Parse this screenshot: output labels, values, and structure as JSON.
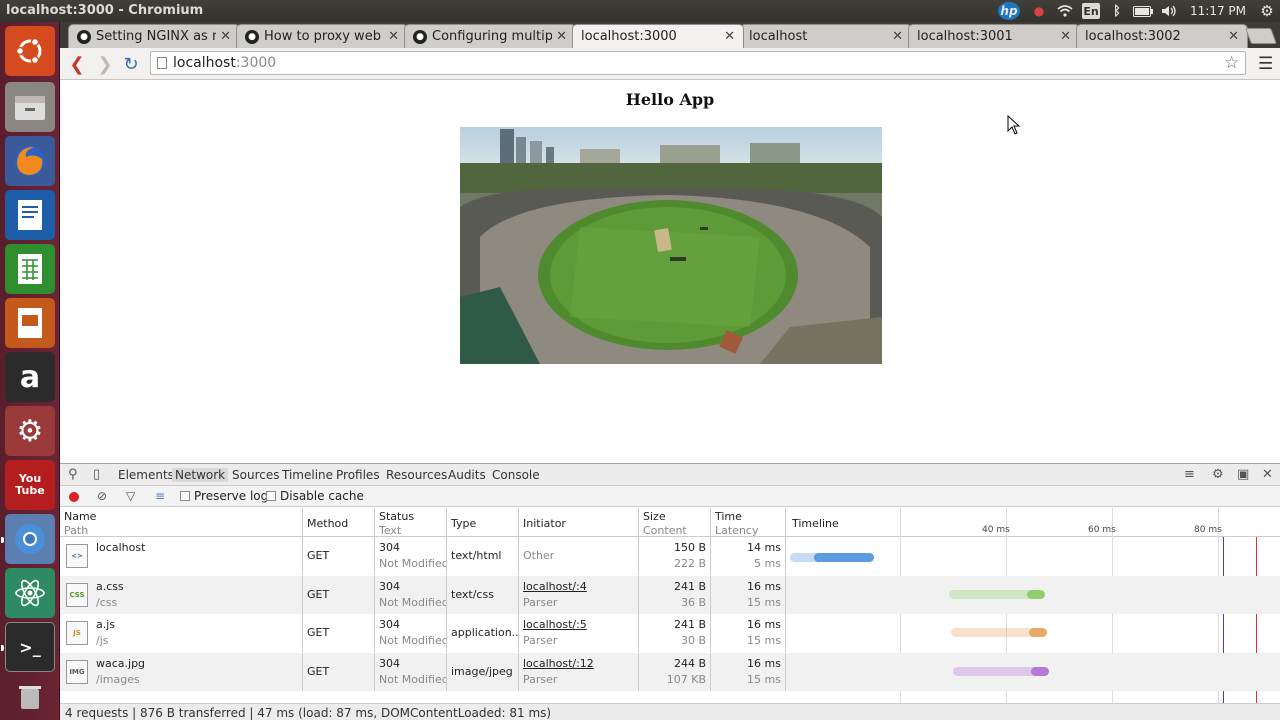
{
  "window": {
    "title": "localhost:3000 - Chromium",
    "clock": "11:17 PM",
    "tray": {
      "lang": "En"
    }
  },
  "launcher": {
    "items": [
      "ubuntu-dash",
      "files",
      "firefox",
      "writer",
      "calc",
      "impress",
      "amazon",
      "system-settings",
      "youtube",
      "chromium",
      "atom",
      "terminal",
      "trash"
    ]
  },
  "tabs": [
    {
      "label": "Setting NGINX as re",
      "icon": "github-icon",
      "active": false
    },
    {
      "label": "How to proxy web a",
      "icon": "github-icon",
      "active": false
    },
    {
      "label": "Configuring multipl",
      "icon": "github-icon",
      "active": false
    },
    {
      "label": "localhost:3000",
      "icon": "",
      "active": true
    },
    {
      "label": "localhost",
      "icon": "",
      "active": false
    },
    {
      "label": "localhost:3001",
      "icon": "",
      "active": false
    },
    {
      "label": "localhost:3002",
      "icon": "",
      "active": false
    }
  ],
  "address": {
    "host": "localhost",
    "port": ":3000"
  },
  "page": {
    "heading": "Hello App"
  },
  "devtools": {
    "tabs": [
      "Elements",
      "Network",
      "Sources",
      "Timeline",
      "Profiles",
      "Resources",
      "Audits",
      "Console"
    ],
    "active_tab": "Network",
    "toolbar": {
      "preserve_log": "Preserve log",
      "disable_cache": "Disable cache"
    },
    "columns": {
      "name": "Name",
      "name_sub": "Path",
      "method": "Method",
      "status": "Status",
      "status_sub": "Text",
      "type": "Type",
      "initiator": "Initiator",
      "size": "Size",
      "size_sub": "Content",
      "time": "Time",
      "time_sub": "Latency",
      "timeline": "Timeline"
    },
    "timeline_ticks": [
      "40 ms",
      "60 ms",
      "80 ms"
    ],
    "rows": [
      {
        "name": "localhost",
        "path": "",
        "method": "GET",
        "status": "304",
        "status_text": "Not Modified",
        "type": "text/html",
        "initiator": "Other",
        "initiator_sub": "",
        "size": "150 B",
        "content": "222 B",
        "time": "14 ms",
        "latency": "5 ms",
        "file_icon": "html-icon",
        "bar_color": "#5b9be0"
      },
      {
        "name": "a.css",
        "path": "/css",
        "method": "GET",
        "status": "304",
        "status_text": "Not Modified",
        "type": "text/css",
        "initiator": "localhost/:4",
        "initiator_sub": "Parser",
        "size": "241 B",
        "content": "36 B",
        "time": "16 ms",
        "latency": "15 ms",
        "file_icon": "css-icon",
        "bar_color": "#8fce6f"
      },
      {
        "name": "a.js",
        "path": "/js",
        "method": "GET",
        "status": "304",
        "status_text": "Not Modified",
        "type": "application...",
        "initiator": "localhost/:5",
        "initiator_sub": "Parser",
        "size": "241 B",
        "content": "30 B",
        "time": "16 ms",
        "latency": "15 ms",
        "file_icon": "js-icon",
        "bar_color": "#e8a967"
      },
      {
        "name": "waca.jpg",
        "path": "/images",
        "method": "GET",
        "status": "304",
        "status_text": "Not Modified",
        "type": "image/jpeg",
        "initiator": "localhost/:12",
        "initiator_sub": "Parser",
        "size": "244 B",
        "content": "107 KB",
        "time": "16 ms",
        "latency": "15 ms",
        "file_icon": "image-icon",
        "bar_color": "#b57ad6"
      }
    ],
    "status": "4 requests  |  876 B transferred  |  47 ms (load: 87 ms, DOMContentLoaded: 81 ms)"
  }
}
